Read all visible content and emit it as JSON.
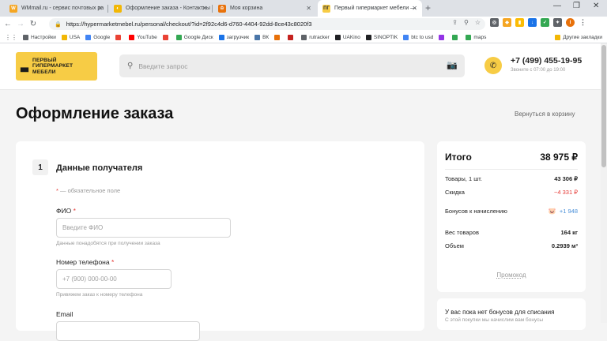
{
  "browser": {
    "tabs": [
      {
        "title": "WMmail.ru - сервис почтовых ра",
        "favicon": "W",
        "color": "#f5a623",
        "active": false
      },
      {
        "title": "Оформление заказа - Контактны",
        "favicon": "◐",
        "color": "#f2b705",
        "active": false
      },
      {
        "title": "Моя корзина",
        "favicon": "♔",
        "color": "#e8710a",
        "active": false
      },
      {
        "title": "Первый гипермаркет мебели —",
        "favicon": "ПГ",
        "color": "#f7cc45",
        "active": true
      }
    ],
    "url": "https://hypermarketmebel.ru/personal/checkout/?id=2f92c4d6-d760-4404-92dd-8ce43c8020f3",
    "bookmarks": [
      {
        "label": "Настройки",
        "color": "#5f6368"
      },
      {
        "label": "USA",
        "color": "#f2b705"
      },
      {
        "label": "Google",
        "color": "#4285f4"
      },
      {
        "label": "",
        "color": "#ea4335"
      },
      {
        "label": "YouTube",
        "color": "#ff0000"
      },
      {
        "label": "",
        "color": "#ea4335"
      },
      {
        "label": "Google Диск",
        "color": "#34a853"
      },
      {
        "label": "загрузчик",
        "color": "#1a73e8"
      },
      {
        "label": "ВК",
        "color": "#4a76a8"
      },
      {
        "label": "",
        "color": "#e8710a"
      },
      {
        "label": "",
        "color": "#c5221f"
      },
      {
        "label": "rutracker",
        "color": "#5f6368"
      },
      {
        "label": "UAKino",
        "color": "#202124"
      },
      {
        "label": "SINOPTIK",
        "color": "#202124"
      },
      {
        "label": "btc to usd",
        "color": "#4285f4"
      },
      {
        "label": "",
        "color": "#9334e6"
      },
      {
        "label": "",
        "color": "#34a853"
      },
      {
        "label": "maps",
        "color": "#34a853"
      }
    ],
    "other_bookmarks": "Другие закладки"
  },
  "header": {
    "logo_line1": "Первый",
    "logo_line2": "гипермаркет",
    "logo_line3": "мебели",
    "search_placeholder": "Введите запрос",
    "phone": "+7 (499) 455-19-95",
    "hours": "Звоните с 07:00 до 19:00"
  },
  "page": {
    "title": "Оформление заказа",
    "back_link": "Вернуться в корзину"
  },
  "recipient": {
    "step_number": "1",
    "step_title": "Данные получателя",
    "required_note": "— обязательное поле",
    "name_label": "ФИО",
    "name_placeholder": "Введите ФИО",
    "name_hint": "Данные понадобятся при получении заказа",
    "phone_label": "Номер телефона",
    "phone_placeholder": "+7 (900) 000-00-00",
    "phone_hint": "Привяжем заказ к номеру телефона",
    "email_label": "Email"
  },
  "summary": {
    "title": "Итого",
    "total": "38 975 ₽",
    "goods_label": "Товары, 1 шт.",
    "goods_value": "43 306 ₽",
    "discount_label": "Скидка",
    "discount_value": "−4 331 ₽",
    "bonus_label": "Бонусов к начислению",
    "bonus_value": "+1 948",
    "weight_label": "Вес товаров",
    "weight_value": "164 кг",
    "volume_label": "Объем",
    "volume_value": "0.2939 м³",
    "promo_link": "Промокод"
  },
  "bonus_card": {
    "title": "У вас пока нет бонусов для списания",
    "subtitle": "С этой покупки мы начислим вам бонусы"
  }
}
